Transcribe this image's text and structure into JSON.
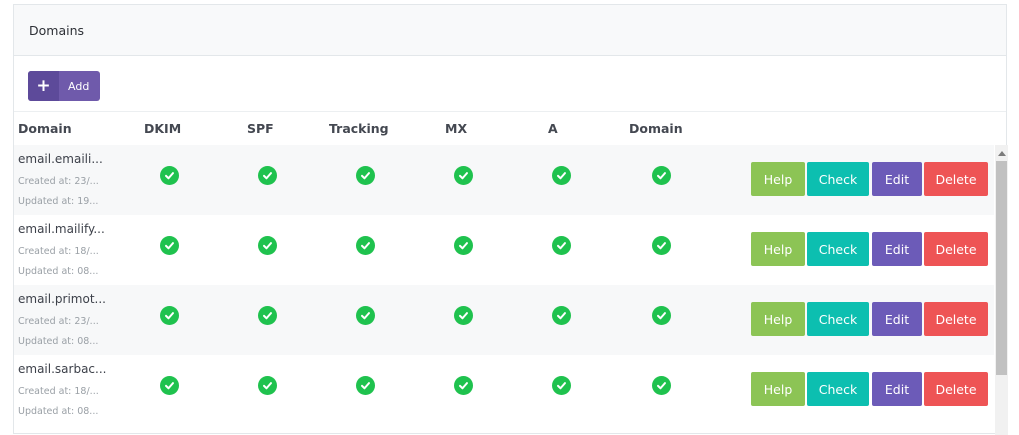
{
  "panel": {
    "title": "Domains"
  },
  "toolbar": {
    "add_icon": "+",
    "add_label": "Add"
  },
  "table": {
    "headers": [
      "Domain",
      "DKIM",
      "SPF",
      "Tracking",
      "MX",
      "A",
      "Domain"
    ],
    "rows": [
      {
        "domain": "email.emaili...",
        "created": "Created at: 23/...",
        "updated": "Updated at: 19..."
      },
      {
        "domain": "email.mailify...",
        "created": "Created at: 18/...",
        "updated": "Updated at: 08..."
      },
      {
        "domain": "email.primot...",
        "created": "Created at: 23/...",
        "updated": "Updated at: 08..."
      },
      {
        "domain": "email.sarbac...",
        "created": "Created at: 18/...",
        "updated": "Updated at: 08..."
      }
    ],
    "status_icon": "check-circle-icon",
    "actions": {
      "help": "Help",
      "check": "Check",
      "edit": "Edit",
      "delete": "Delete"
    }
  },
  "colors": {
    "add": "#6f5aab",
    "check_ok": "#1fc24e",
    "help": "#8cc455",
    "check": "#0cbfb0",
    "edit": "#6c5bb8",
    "delete": "#ee5455"
  }
}
